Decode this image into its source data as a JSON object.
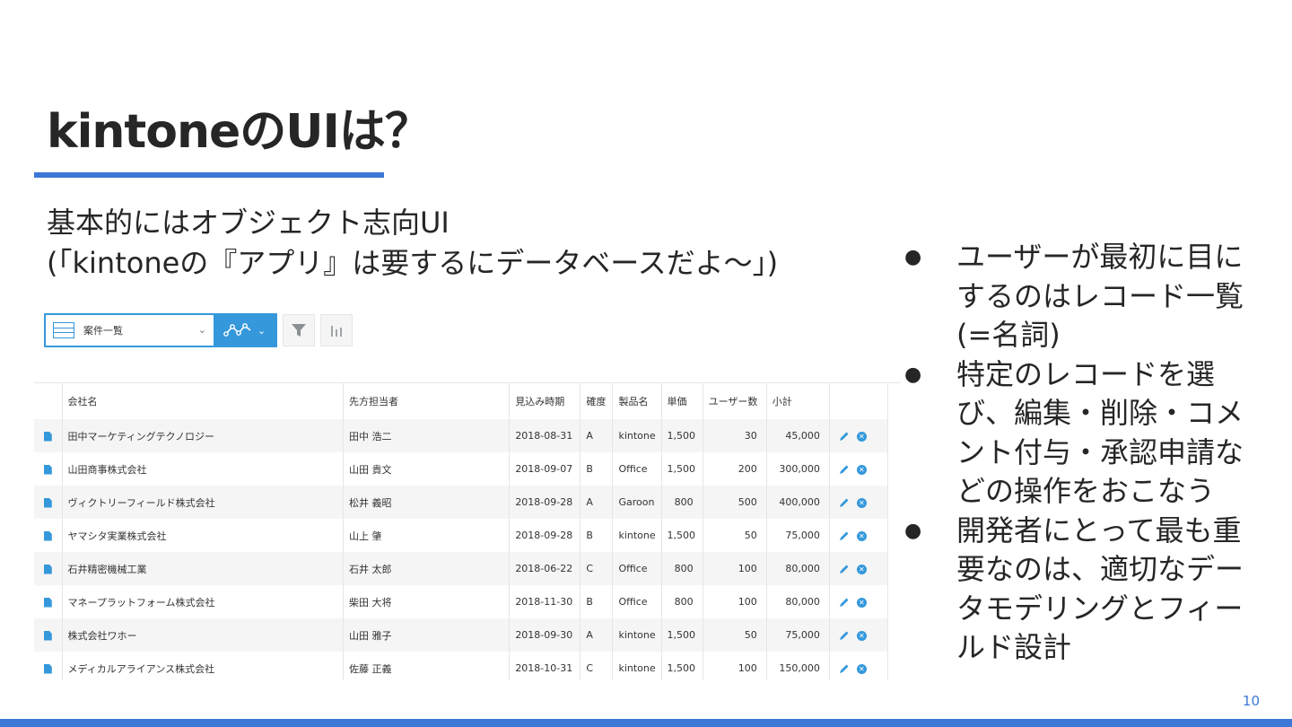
{
  "slide": {
    "title": "kintoneのUIは？",
    "subtitle_line1": "基本的にはオブジェクト志向UI",
    "subtitle_line2": "(「kintoneの『アプリ』は要するにデータベースだよ～」)",
    "page_number": "10",
    "accent_color": "#3c78d8"
  },
  "toolbar": {
    "view_name": "案件一覧",
    "icons": [
      "list-view-icon",
      "chevron-down-icon",
      "graph-icon",
      "filter-icon",
      "bar-chart-icon"
    ]
  },
  "table": {
    "columns": [
      "会社名",
      "先方担当者",
      "見込み時期",
      "確度",
      "製品名",
      "単価",
      "ユーザー数",
      "小計"
    ],
    "rows": [
      [
        "田中マーケティングテクノロジー",
        "田中 浩二",
        "2018-08-31",
        "A",
        "kintone",
        "1,500",
        "30",
        "45,000"
      ],
      [
        "山田商事株式会社",
        "山田 貴文",
        "2018-09-07",
        "B",
        "Office",
        "1,500",
        "200",
        "300,000"
      ],
      [
        "ヴィクトリーフィールド株式会社",
        "松井 義昭",
        "2018-09-28",
        "A",
        "Garoon",
        "800",
        "500",
        "400,000"
      ],
      [
        "ヤマシタ実業株式会社",
        "山上 肇",
        "2018-09-28",
        "B",
        "kintone",
        "1,500",
        "50",
        "75,000"
      ],
      [
        "石井精密機械工業",
        "石井 太郎",
        "2018-06-22",
        "C",
        "Office",
        "800",
        "100",
        "80,000"
      ],
      [
        "マネープラットフォーム株式会社",
        "柴田 大将",
        "2018-11-30",
        "B",
        "Office",
        "800",
        "100",
        "80,000"
      ],
      [
        "株式会社ワホー",
        "山田 雅子",
        "2018-09-30",
        "A",
        "kintone",
        "1,500",
        "50",
        "75,000"
      ],
      [
        "メディカルアライアンス株式会社",
        "佐藤 正義",
        "2018-10-31",
        "C",
        "kintone",
        "1,500",
        "100",
        "150,000"
      ]
    ],
    "row_colors": {
      "alternate": "#f5f5f5",
      "icon": "#3498db"
    }
  },
  "bullets": [
    "ユーザーが最初に目にするのはレコード一覧(=名詞)",
    "特定のレコードを選び、編集・削除・コメント付与・承認申請などの操作をおこなう",
    "開発者にとって最も重要なのは、適切なデータモデリングとフィールド設計"
  ]
}
